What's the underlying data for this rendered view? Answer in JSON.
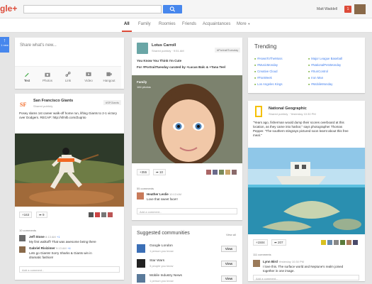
{
  "header": {
    "logo": "gle+",
    "search_placeholder": "",
    "user_name": "Matt Waddell",
    "notification_count": "1"
  },
  "nav": {
    "tabs": [
      "All",
      "Family",
      "Roomies",
      "Friends",
      "Acquaintances",
      "More"
    ],
    "active": "All"
  },
  "share": {
    "new_label": "1 new",
    "prompt": "Share what's new...",
    "actions": [
      "Text",
      "Photos",
      "Link",
      "Video",
      "Hangout"
    ]
  },
  "post_sf": {
    "author": "San Francisco Giants",
    "meta": "Shared publicly",
    "tag": "#SFGiants",
    "text1": "Posey slams 1st career walk-off home run, lifting Giants to 2-1 victory",
    "text2": "over Dodgers. RECAP: http://sfmlb.com/Zuqnto",
    "plus_count": "+163",
    "share_count": "9",
    "comments_count": "10 comments",
    "comments": [
      {
        "author": "Jeff Stone",
        "time": "8:13 AM",
        "plus": "+1",
        "text": "My first walkoff! That was awesome being there"
      },
      {
        "author": "Gabriel Rivizimer",
        "time": "9:13 AM",
        "plus": "+4",
        "text1": "Lets go Giants! Sorry Sharks & Giants win in",
        "text2": "dramatic fashion!"
      }
    ],
    "add_comment": "Add a comment..."
  },
  "post_lotus": {
    "author": "Lotus Carroll",
    "meta": "Shared publicly  ·  9:51 AM",
    "tag": "#PortraitTuesday",
    "text1": "You Know You Think I'm Cute",
    "text2": "For #PortraitTuesday curated by +Lucas Balc & +Tana Teel",
    "overlay_title": "Family",
    "overlay_sub": "184 photos",
    "plus_count": "+355",
    "share_count": "10",
    "comments_count": "55 comments",
    "comment": {
      "author": "Heather Leslie",
      "time": "10:13 AM",
      "text": "Love that sweet face!!"
    },
    "add_comment": "Add a comment..."
  },
  "communities": {
    "title": "Suggested communities",
    "view_all": "View all",
    "items": [
      {
        "name": "Google London",
        "count": "1 person you know",
        "button": "View"
      },
      {
        "name": "Star Wars",
        "count": "3 people you know",
        "button": "View"
      },
      {
        "name": "Mobile Industry News",
        "count": "1 person you know",
        "button": "View"
      }
    ]
  },
  "trending": {
    "title": "Trending",
    "left": [
      "#HowsToTheMoss",
      "#MusicMonday",
      "Creative Cloud",
      "#FanWeek",
      "Los Angeles Kings"
    ],
    "right": [
      "Major League Baseball",
      "#NationalPetsMonday",
      "#SunControl",
      "Iron Man",
      "#MobileMonday"
    ]
  },
  "post_natgeo": {
    "author": "National Geographic",
    "meta": "Shared publicly  ·  Yesterday 10:30 PM",
    "text1": "\"Years ago, fisherman would dump their scores overboard at this",
    "text2": "location, as they came into harbor,\" says photographer Thomas",
    "text3": "Pepper. \"The southern stingrays pictured soon learnt about this free",
    "text4": "meal.\"",
    "plus_count": "+1504",
    "share_count": "207",
    "comments_count": "111 comments",
    "comment": {
      "author": "Lynn Bird",
      "time": "Yesterday 10:30 PM",
      "text1": "I love this. The surface world and Neptune's realm joined",
      "text2": "together in one image."
    },
    "add_comment": "Add a comment..."
  }
}
